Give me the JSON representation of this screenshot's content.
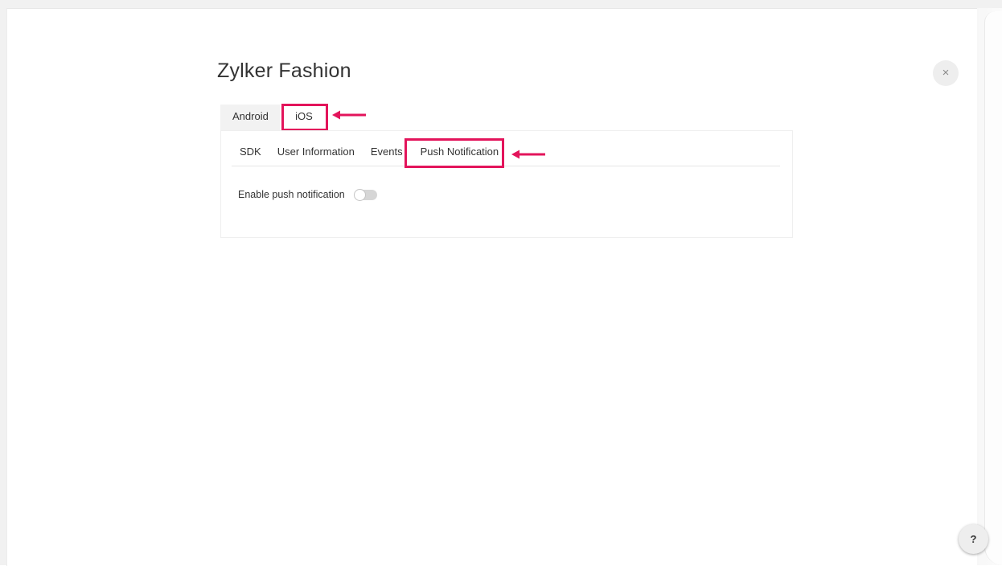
{
  "dialog": {
    "title": "Zylker Fashion",
    "close_icon": "×"
  },
  "platform_tabs": [
    {
      "label": "Android",
      "selected": false
    },
    {
      "label": "iOS",
      "selected": true
    }
  ],
  "sub_tabs": [
    {
      "label": "SDK",
      "selected": false
    },
    {
      "label": "User Information",
      "selected": false
    },
    {
      "label": "Events",
      "selected": false
    },
    {
      "label": "Push Notification",
      "selected": true
    }
  ],
  "push": {
    "toggle_label": "Enable push notification",
    "enabled": false
  },
  "help": {
    "label": "?"
  },
  "annotations": {
    "highlight_color": "#e3145b",
    "highlighted": [
      "iOS",
      "Push Notification"
    ]
  },
  "colors": {
    "accent": "#e3145b",
    "toggle_off": "#d6d6d6"
  }
}
